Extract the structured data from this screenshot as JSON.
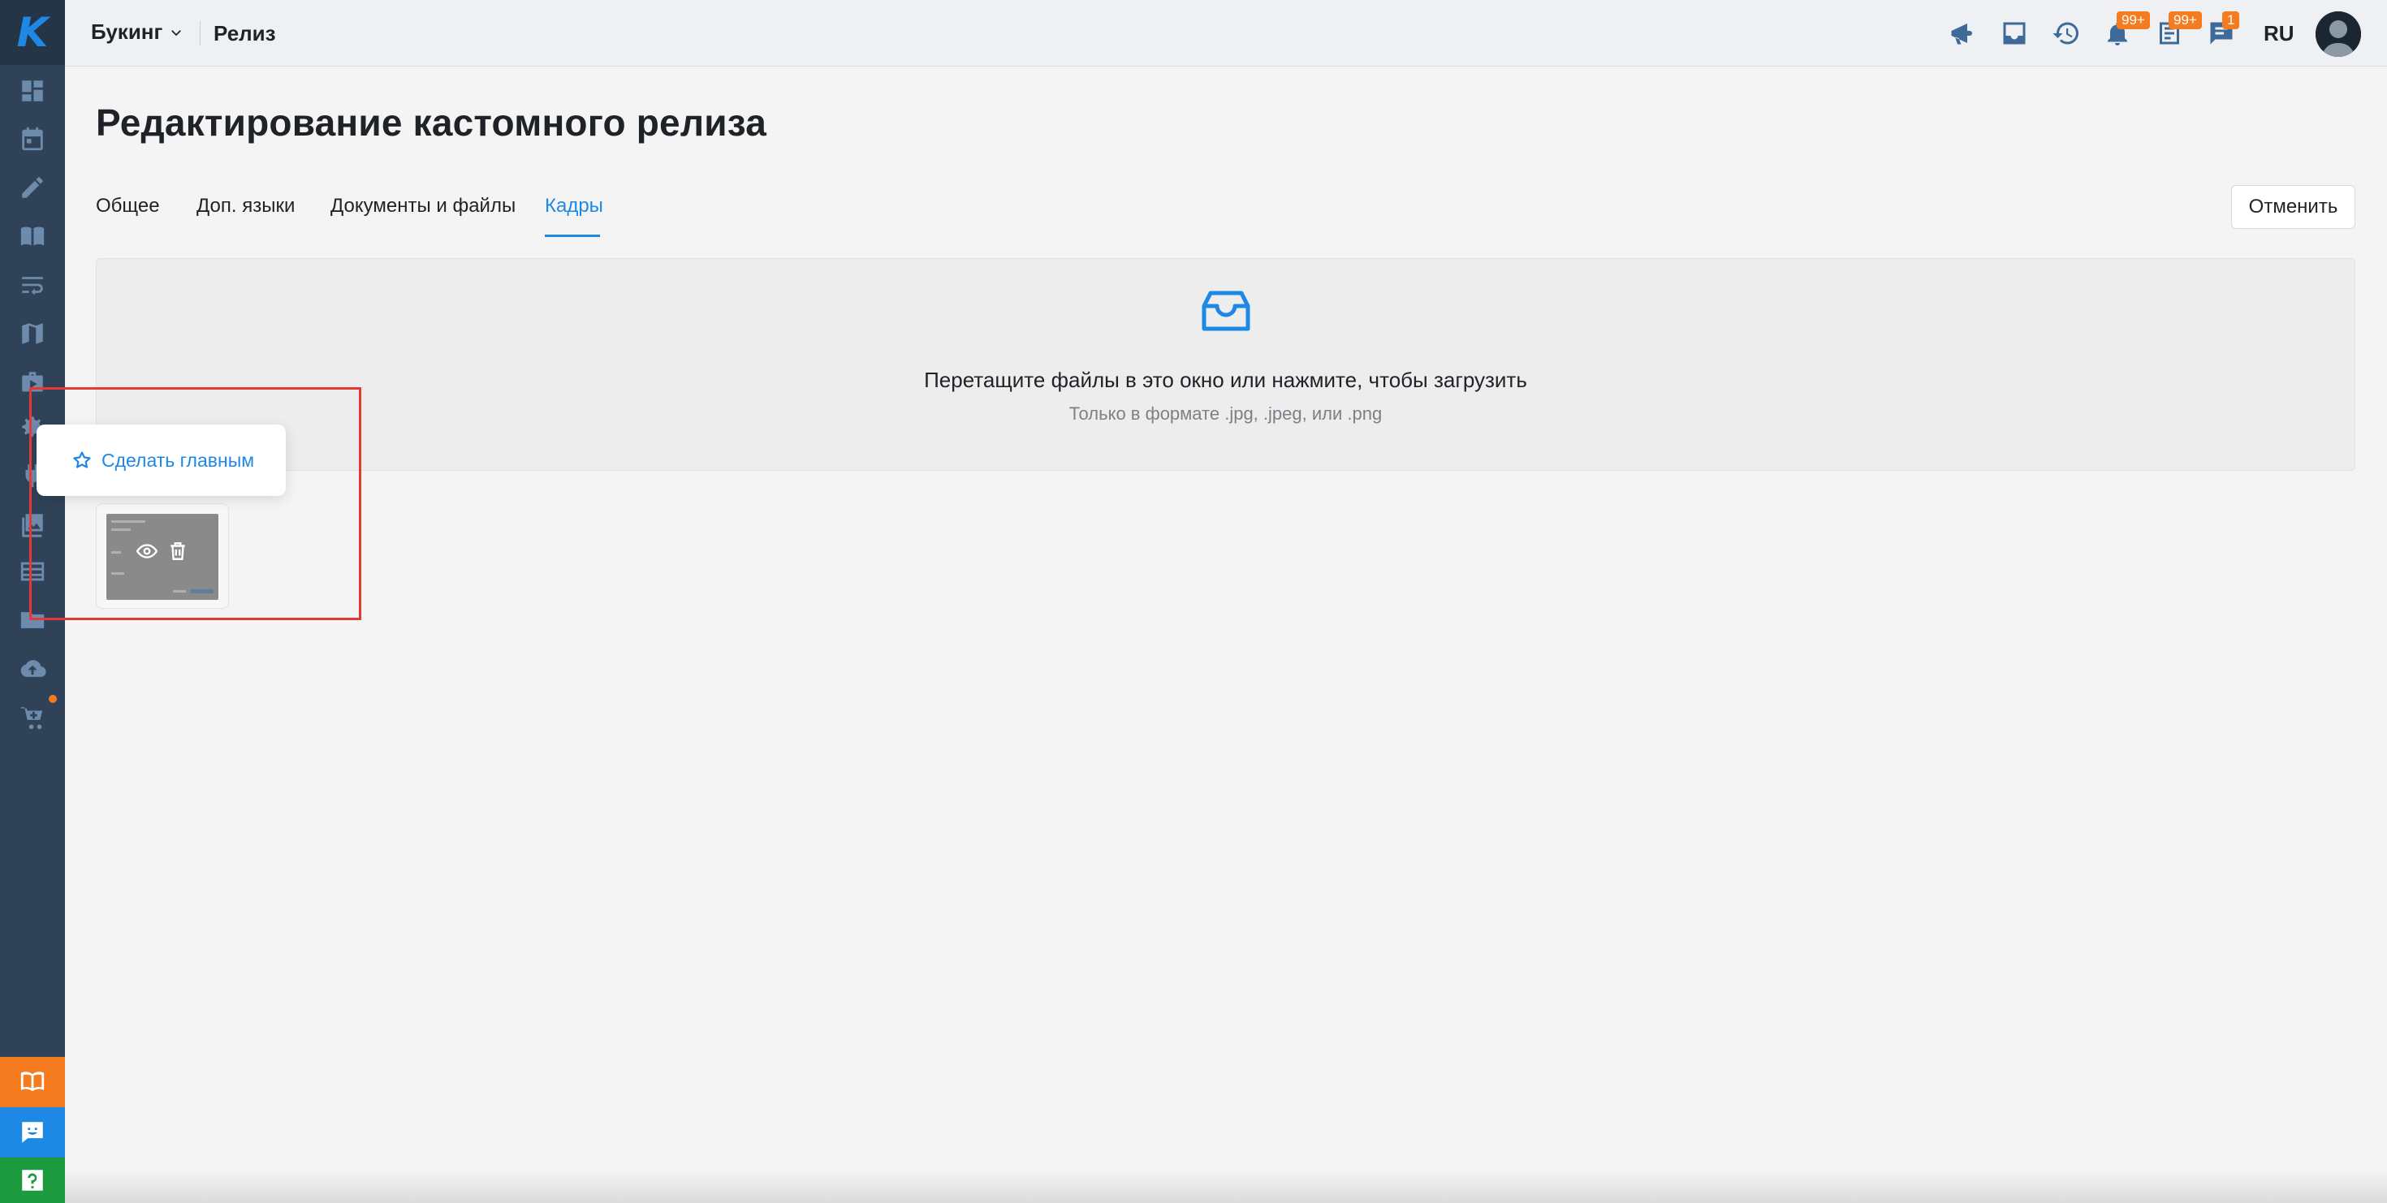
{
  "sidebar": {
    "logo": "K",
    "items": [
      {
        "icon": "dashboard-icon"
      },
      {
        "icon": "calendar-icon"
      },
      {
        "icon": "pencil-icon"
      },
      {
        "icon": "book-icon"
      },
      {
        "icon": "wrap-text-icon"
      },
      {
        "icon": "map-icon"
      },
      {
        "icon": "briefcase-play-icon"
      },
      {
        "icon": "settings-icon"
      },
      {
        "icon": "plug-icon"
      },
      {
        "icon": "gallery-icon"
      },
      {
        "icon": "list-icon"
      },
      {
        "icon": "folder-icon"
      },
      {
        "icon": "cloud-upload-icon"
      },
      {
        "icon": "cart-icon"
      }
    ],
    "bottom": [
      {
        "icon": "book-open-icon",
        "color": "#f47b20"
      },
      {
        "icon": "chat-bot-icon",
        "color": "#1e88e5"
      },
      {
        "icon": "help-icon",
        "color": "#1b9a3f"
      }
    ]
  },
  "topbar": {
    "project": "Букинг",
    "page": "Релиз",
    "icons": [
      {
        "icon": "megaphone-icon",
        "badge": ""
      },
      {
        "icon": "inbox-icon",
        "badge": ""
      },
      {
        "icon": "history-icon",
        "badge": ""
      },
      {
        "icon": "bell-icon",
        "badge": "99+"
      },
      {
        "icon": "tasks-icon",
        "badge": "99+"
      },
      {
        "icon": "messages-icon",
        "badge": "1"
      }
    ],
    "lang": "RU"
  },
  "page": {
    "title": "Редактирование кастомного релиза",
    "tabs": [
      {
        "label": "Общее",
        "active": false
      },
      {
        "label": "Доп. языки",
        "active": false
      },
      {
        "label": "Документы и файлы",
        "active": false
      },
      {
        "label": "Кадры",
        "active": true
      }
    ],
    "cancel_label": "Отменить"
  },
  "upload": {
    "main_text": "Перетащите файлы в это окно или нажмите, чтобы загрузить",
    "hint_text": "Только в формате .jpg, .jpeg, или .png"
  },
  "popover": {
    "label": "Сделать главным"
  },
  "colors": {
    "accent": "#1e88e5",
    "sidebar": "#2f4257",
    "badge": "#f47b20",
    "highlight": "#e53935"
  }
}
